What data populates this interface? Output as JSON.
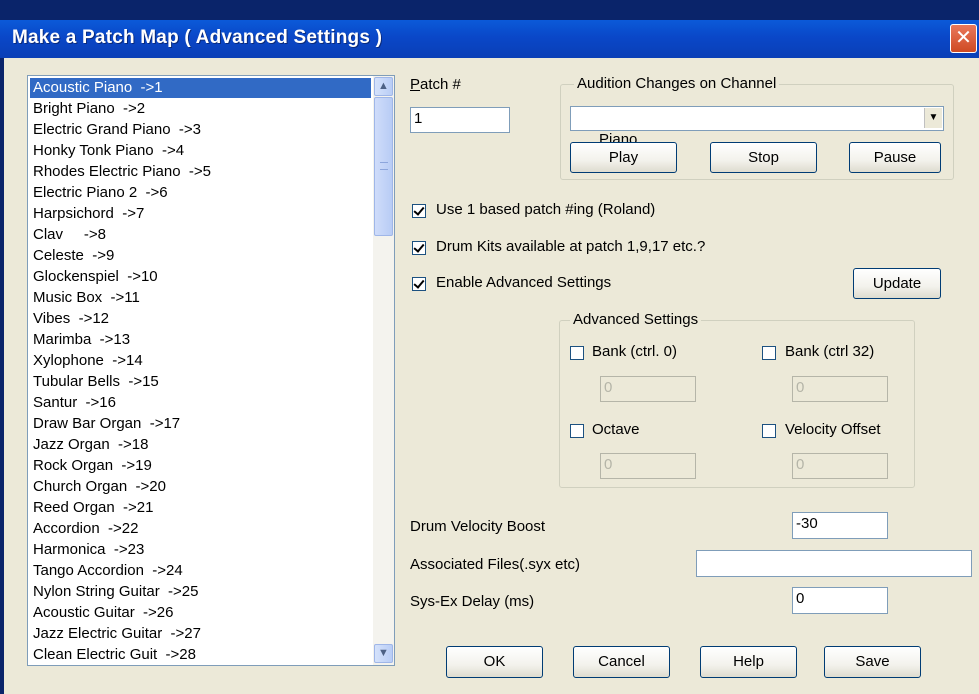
{
  "window": {
    "title": "Make a Patch Map ( Advanced Settings )"
  },
  "patch_list": {
    "items": [
      "Acoustic Piano  ->1",
      "Bright Piano  ->2",
      "Electric Grand Piano  ->3",
      "Honky Tonk Piano  ->4",
      "Rhodes Electric Piano  ->5",
      "Electric Piano 2  ->6",
      "Harpsichord  ->7",
      "Clav     ->8",
      "Celeste  ->9",
      "Glockenspiel  ->10",
      "Music Box  ->11",
      "Vibes  ->12",
      "Marimba  ->13",
      "Xylophone  ->14",
      "Tubular Bells  ->15",
      "Santur  ->16",
      "Draw Bar Organ  ->17",
      "Jazz Organ  ->18",
      "Rock Organ  ->19",
      "Church Organ  ->20",
      "Reed Organ  ->21",
      "Accordion  ->22",
      "Harmonica  ->23",
      "Tango Accordion  ->24",
      "Nylon String Guitar  ->25",
      "Acoustic Guitar  ->26",
      "Jazz Electric Guitar  ->27",
      "Clean Electric Guit  ->28"
    ],
    "selected_index": 0
  },
  "patch_number": {
    "label": "Patch #",
    "value": "1"
  },
  "audition": {
    "group_label": "Audition Changes on Channel",
    "channel_value": "Piano",
    "play_label": "Play",
    "stop_label": "Stop",
    "pause_label": "Pause"
  },
  "options": {
    "one_based_label": "Use 1 based patch #ing (Roland)",
    "one_based_checked": true,
    "drum_kits_label": "Drum Kits available at patch 1,9,17 etc.?",
    "drum_kits_checked": true,
    "enable_advanced_label": "Enable Advanced Settings",
    "enable_advanced_checked": true,
    "update_label": "Update"
  },
  "advanced": {
    "group_label": "Advanced Settings",
    "bank_ctrl0_label": "Bank (ctrl. 0)",
    "bank_ctrl0_value": "0",
    "bank_ctrl32_label": "Bank (ctrl 32)",
    "bank_ctrl32_value": "0",
    "octave_label": "Octave",
    "octave_value": "0",
    "velocity_offset_label": "Velocity Offset",
    "velocity_offset_value": "0"
  },
  "drum_velocity": {
    "label": "Drum Velocity Boost",
    "value": "-30"
  },
  "associated_files": {
    "label": "Associated Files(.syx etc)",
    "value": ""
  },
  "sysex_delay": {
    "label": "Sys-Ex Delay (ms)",
    "value": "0"
  },
  "footer": {
    "ok_label": "OK",
    "cancel_label": "Cancel",
    "help_label": "Help",
    "save_label": "Save"
  }
}
